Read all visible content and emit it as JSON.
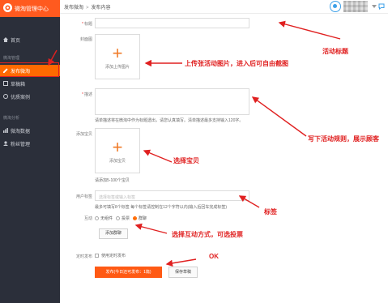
{
  "colors": {
    "accent": "#ff6a00",
    "annotation": "#e02020",
    "sidebar": "#2b2f3a"
  },
  "app": {
    "title": "微淘管理中心"
  },
  "breadcrumb": {
    "parent": "发布微淘",
    "separator": ">",
    "current": "发布内容"
  },
  "sidebar": {
    "home": "首页",
    "group1_label": "微淘管理",
    "items": [
      {
        "label": "发布微淘",
        "icon": "edit-icon",
        "active": true
      },
      {
        "label": "草稿箱",
        "icon": "draft-icon",
        "active": false
      },
      {
        "label": "优质案例",
        "icon": "case-icon",
        "active": false
      }
    ],
    "group2_label": "微淘分析",
    "items2": [
      {
        "label": "微淘数据",
        "icon": "data-icon"
      },
      {
        "label": "粉丝管理",
        "icon": "fans-icon"
      }
    ]
  },
  "form": {
    "title_label": "标题",
    "cover_label": "封面图",
    "cover_upload_caption": "添加上传图片",
    "desc_label": "描述",
    "desc_hint": "请单描述将在微淘中作为标题透出，请您认真填写。清单描述最多支持输入120字。",
    "product_label": "添加宝贝",
    "product_upload_caption": "添加宝贝",
    "product_hint": "请添加5-100个宝贝",
    "tags_label": "用户标签",
    "tags_placeholder": "选择标签或输入标签",
    "tags_hint": "最多可填写8个标签 每个标签请控制在12个字符以内(输入后回车完成标签)",
    "interact_label": "互动",
    "interact_options": [
      "无组件",
      "投票",
      "群聊"
    ],
    "interact_selected": "群聊",
    "add_group_button": "添加群聊",
    "schedule_label": "定时发布",
    "schedule_option": "使用定时发布",
    "publish_button": "发布(今日还可发布：1篇)",
    "save_button": "保存草稿"
  },
  "annotations": {
    "title_note": "活动标题",
    "cover_note": "上传张活动图片，进入后可自由截图",
    "desc_note": "写下活动规则，展示顾客",
    "product_note": "选择宝贝",
    "tags_note": "标签",
    "interact_note": "选择互动方式，可选投票",
    "ok_note": "OK"
  }
}
